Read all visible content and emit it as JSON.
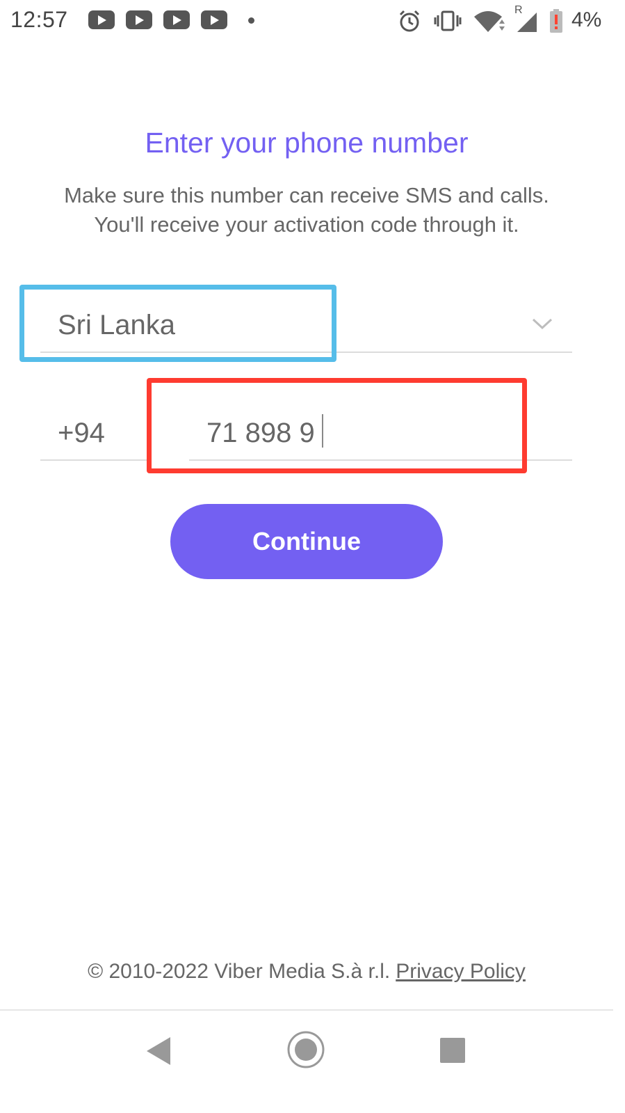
{
  "status_bar": {
    "time": "12:57",
    "battery_percent": "4%",
    "roaming_label": "R",
    "notification_icons": [
      "youtube-icon",
      "youtube-icon",
      "youtube-icon",
      "youtube-icon",
      "more-notifications-dot"
    ],
    "system_icons": [
      "alarm-icon",
      "vibrate-icon",
      "wifi-icon",
      "signal-icon",
      "battery-low-icon"
    ]
  },
  "header": {
    "title": "Enter your phone number",
    "subtitle_line1": "Make sure this number can receive SMS and calls.",
    "subtitle_line2": "You'll receive your activation code through it."
  },
  "form": {
    "country": "Sri Lanka",
    "country_code": "+94",
    "phone_value": "71 898 9",
    "continue_label": "Continue"
  },
  "footer": {
    "copyright": "© 2010-2022 Viber Media S.à r.l.",
    "privacy_link": "Privacy Policy"
  },
  "colors": {
    "accent": "#7360f2",
    "highlight_country": "#56bde9",
    "highlight_phone": "#fe3b30"
  },
  "navigation": {
    "icons": [
      "back-icon",
      "home-icon",
      "recents-icon"
    ]
  }
}
